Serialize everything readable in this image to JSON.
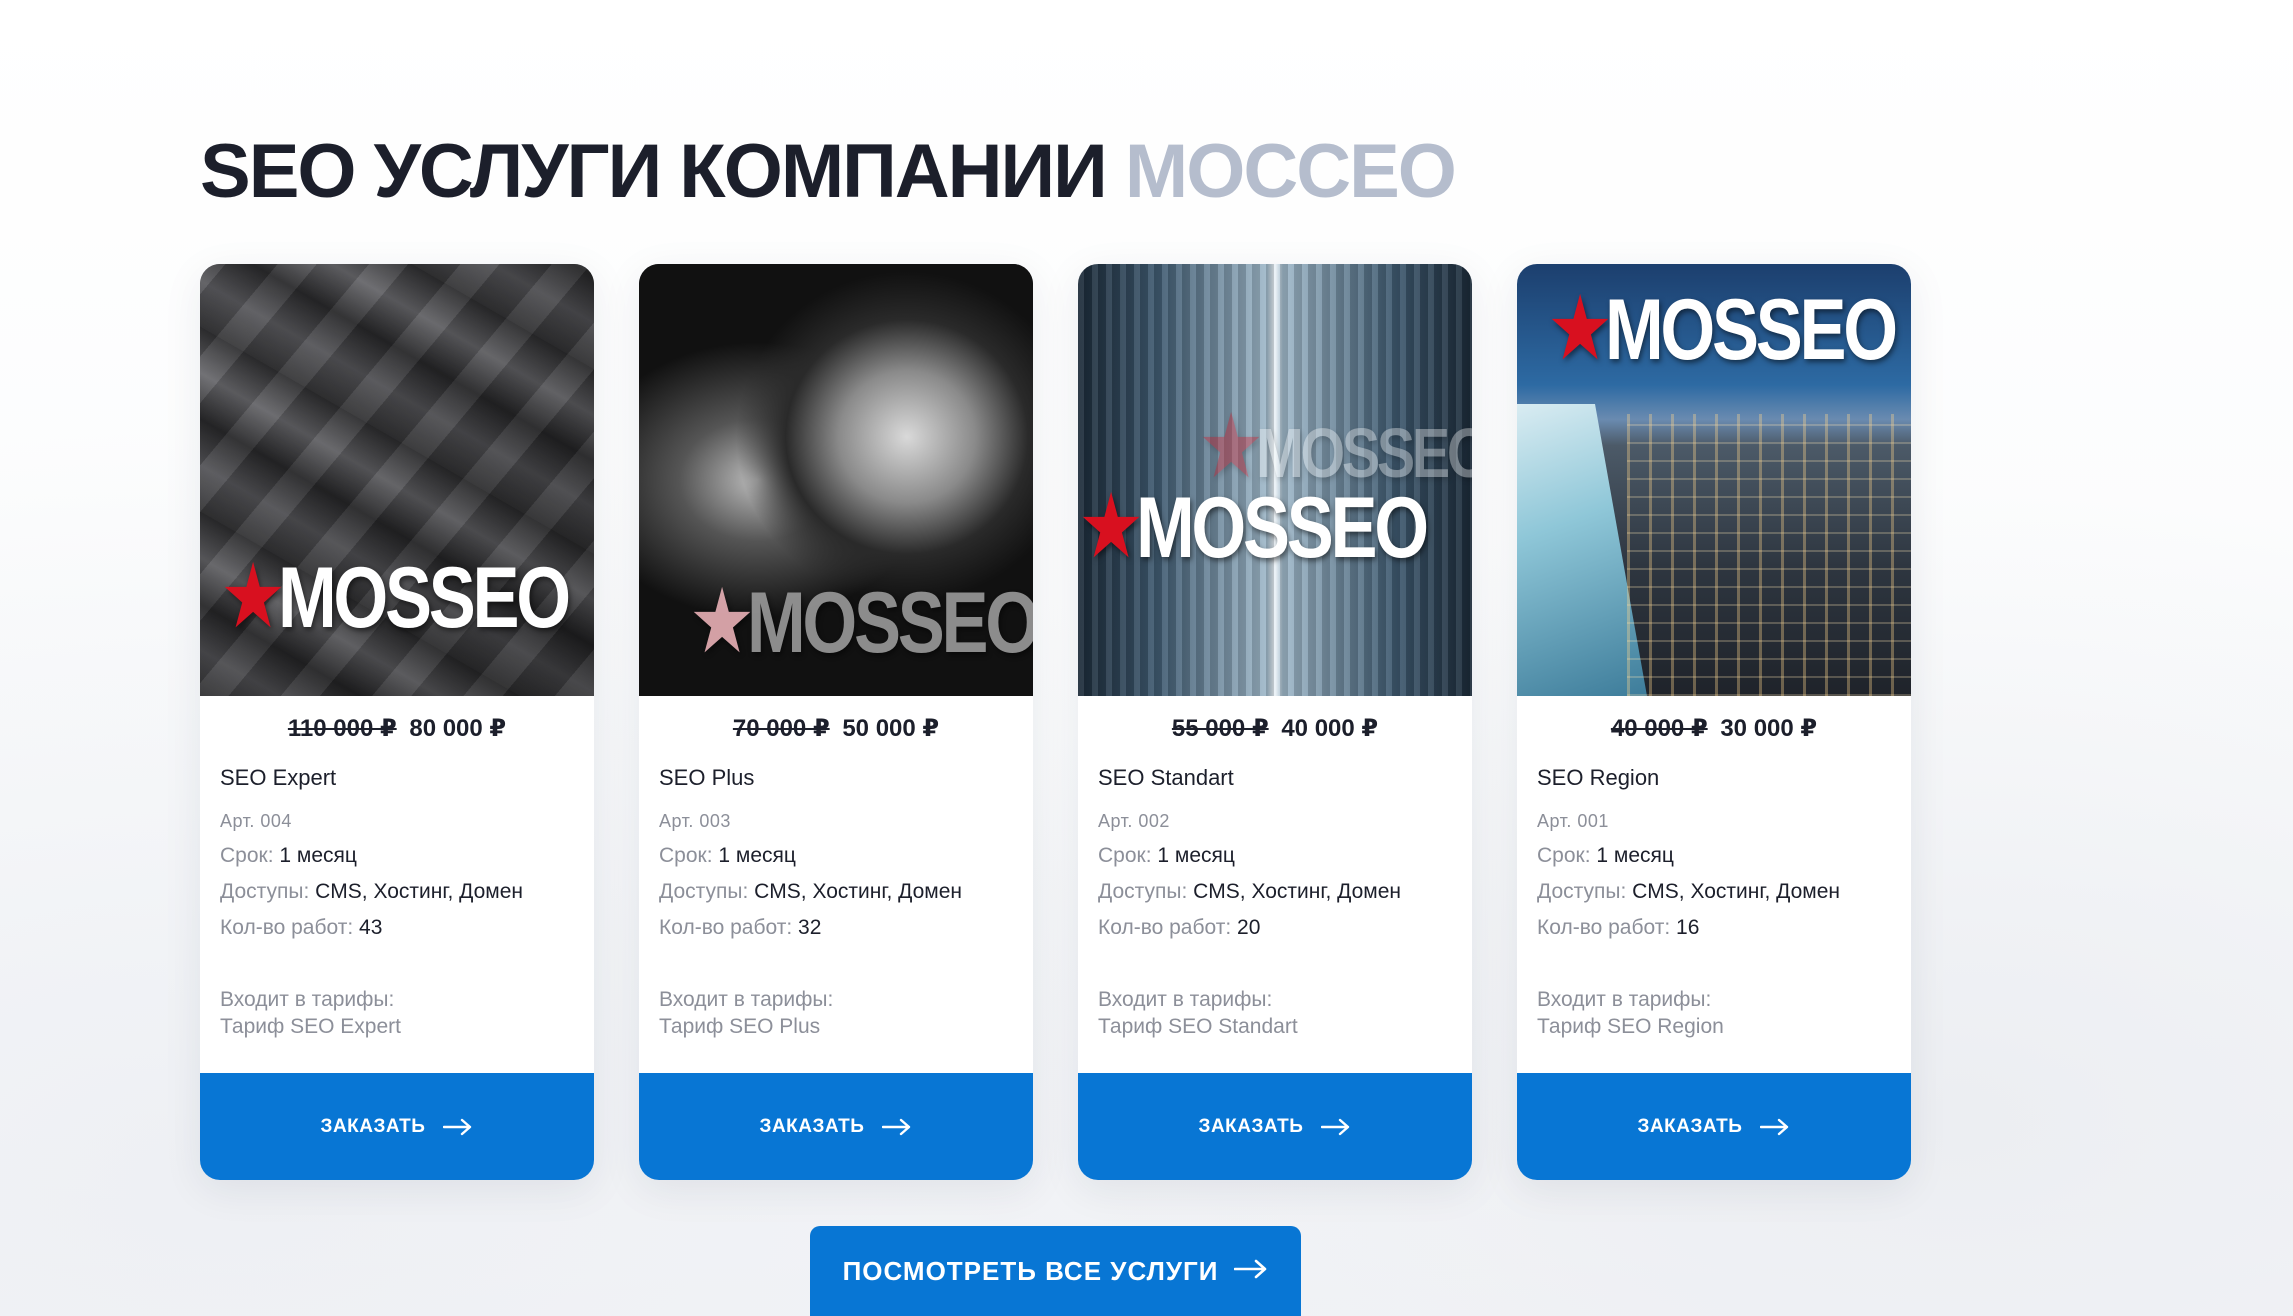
{
  "section": {
    "title_main": "SEO УСЛУГИ КОМПАНИИ",
    "title_accent": "МОССЕО",
    "all_services_label": "ПОСМОТРЕТЬ ВСЕ УСЛУГИ"
  },
  "common": {
    "logo_text": "MOSSEO",
    "logo_star": "★",
    "order_label": "ЗАКАЗАТЬ",
    "term_label": "Срок:",
    "access_label": "Доступы:",
    "works_label": "Кол-во работ:",
    "tariffs_label": "Входит в тарифы:"
  },
  "cards": [
    {
      "old_price": "110 000 ₽",
      "price": "80 000 ₽",
      "name": "SEO Expert",
      "art": "Арт. 004",
      "term": "1 месяц",
      "access": "CMS, Хостинг, Домен",
      "works": "43",
      "tariff": "Тариф SEO Expert"
    },
    {
      "old_price": "70 000 ₽",
      "price": "50 000 ₽",
      "name": "SEO Plus",
      "art": "Арт. 003",
      "term": "1 месяц",
      "access": "CMS, Хостинг, Домен",
      "works": "32",
      "tariff": "Тариф SEO Plus"
    },
    {
      "old_price": "55 000 ₽",
      "price": "40 000 ₽",
      "name": "SEO Standart",
      "art": "Арт. 002",
      "term": "1 месяц",
      "access": "CMS, Хостинг, Домен",
      "works": "20",
      "tariff": "Тариф SEO Standart"
    },
    {
      "old_price": "40 000 ₽",
      "price": "30 000 ₽",
      "name": "SEO Region",
      "art": "Арт. 001",
      "term": "1 месяц",
      "access": "CMS, Хостинг, Домен",
      "works": "16",
      "tariff": "Тариф SEO Region"
    }
  ],
  "colors": {
    "primary_blue": "#0876d4",
    "title_dark": "#1c1f2b",
    "title_accent": "#b5bdcd",
    "label_gray": "#8c8f99",
    "logo_star_red": "#d8101f"
  }
}
